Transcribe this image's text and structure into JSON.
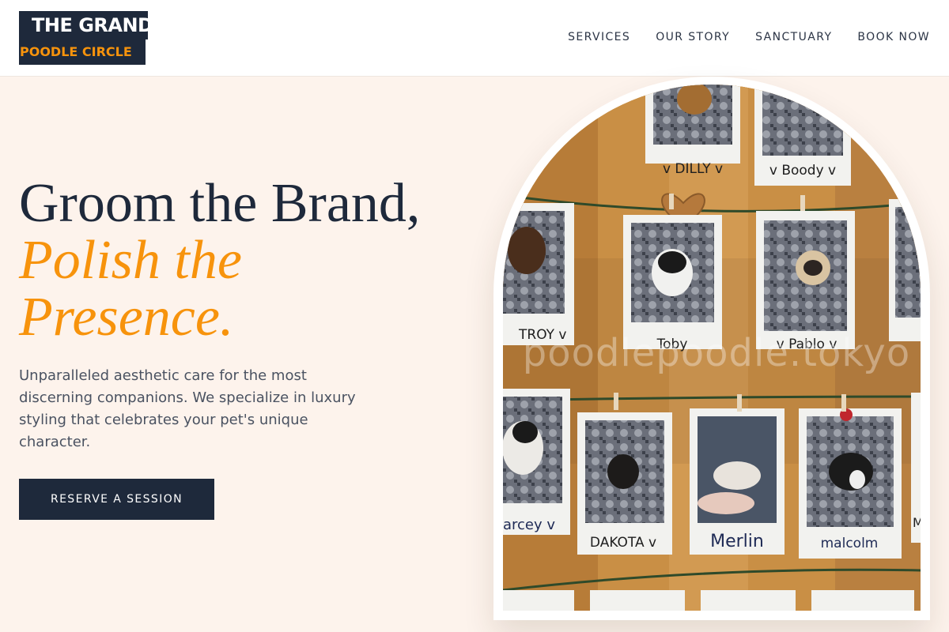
{
  "header": {
    "logo_top": "THE GRAND",
    "logo_bottom": "POODLE CIRCLE",
    "nav": [
      "SERVICES",
      "OUR STORY",
      "SANCTUARY",
      "BOOK NOW"
    ]
  },
  "hero": {
    "headline_line1": "Groom the Brand,",
    "headline_line2": "Polish the",
    "headline_line3": "Presence.",
    "subcopy": "Unparalleled aesthetic care for the most discerning companions. We specialize in luxury styling that celebrates your pet's unique character.",
    "cta_label": "RESERVE A SESSION"
  },
  "photo": {
    "watermark": "poodlepoodle.tokyo",
    "polaroid_names": [
      "DILLY",
      "Boody",
      "TROY",
      "Toby",
      "Pablo",
      "arcey",
      "DAKOTA",
      "Merlin",
      "malcolm",
      "Ma"
    ]
  },
  "colors": {
    "navy": "#1e293b",
    "accent_orange": "#f7930c",
    "cream_background": "#fdf3ec",
    "body_text": "#4a5261"
  }
}
